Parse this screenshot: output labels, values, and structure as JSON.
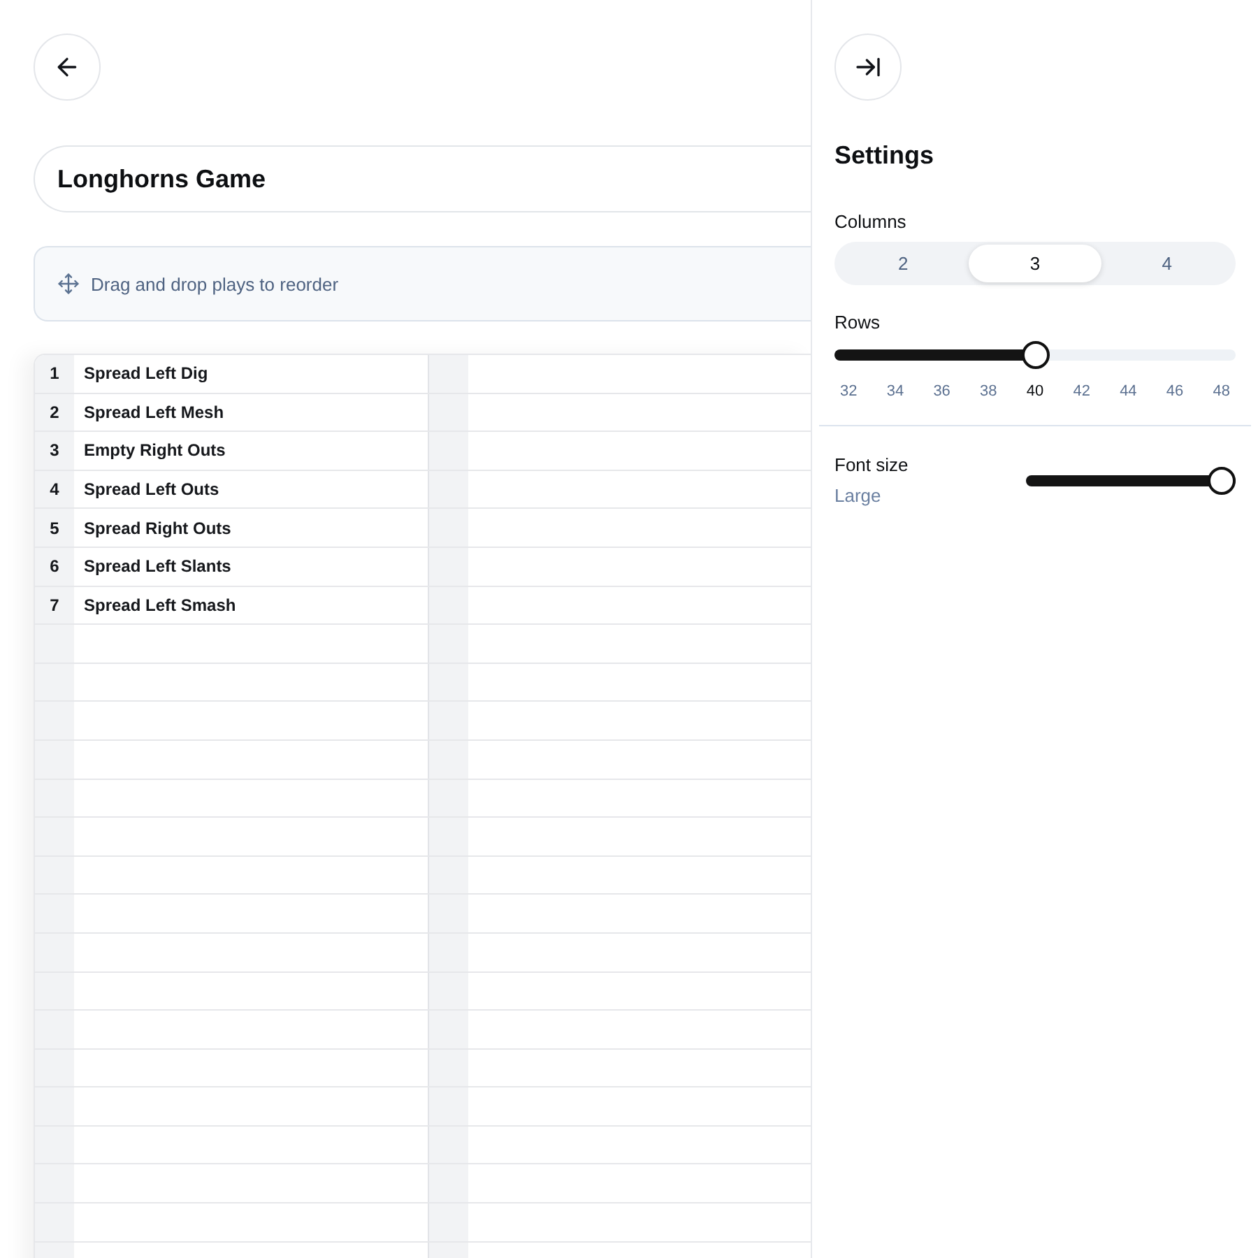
{
  "title_field": {
    "value": "Longhorns Game"
  },
  "hint": {
    "text": "Drag and drop plays to reorder"
  },
  "sheet": {
    "plays": [
      {
        "number": "1",
        "name": "Spread Left Dig"
      },
      {
        "number": "2",
        "name": "Spread Left Mesh"
      },
      {
        "number": "3",
        "name": "Empty Right Outs"
      },
      {
        "number": "4",
        "name": "Spread Left Outs"
      },
      {
        "number": "5",
        "name": "Spread Right Outs"
      },
      {
        "number": "6",
        "name": "Spread Left Slants"
      },
      {
        "number": "7",
        "name": "Spread Left Smash"
      }
    ]
  },
  "settings": {
    "title": "Settings",
    "columns": {
      "label": "Columns",
      "options": [
        {
          "label": "2",
          "selected": false
        },
        {
          "label": "3",
          "selected": true
        },
        {
          "label": "4",
          "selected": false
        }
      ]
    },
    "rows": {
      "label": "Rows",
      "level": 0.5,
      "ticks": [
        {
          "label": "32",
          "selected": false
        },
        {
          "label": "34",
          "selected": false
        },
        {
          "label": "36",
          "selected": false
        },
        {
          "label": "38",
          "selected": false
        },
        {
          "label": "40",
          "selected": true
        },
        {
          "label": "42",
          "selected": false
        },
        {
          "label": "44",
          "selected": false
        },
        {
          "label": "46",
          "selected": false
        },
        {
          "label": "48",
          "selected": false
        }
      ]
    },
    "font_size": {
      "label": "Font size",
      "value": "Large",
      "level": 1
    }
  }
}
